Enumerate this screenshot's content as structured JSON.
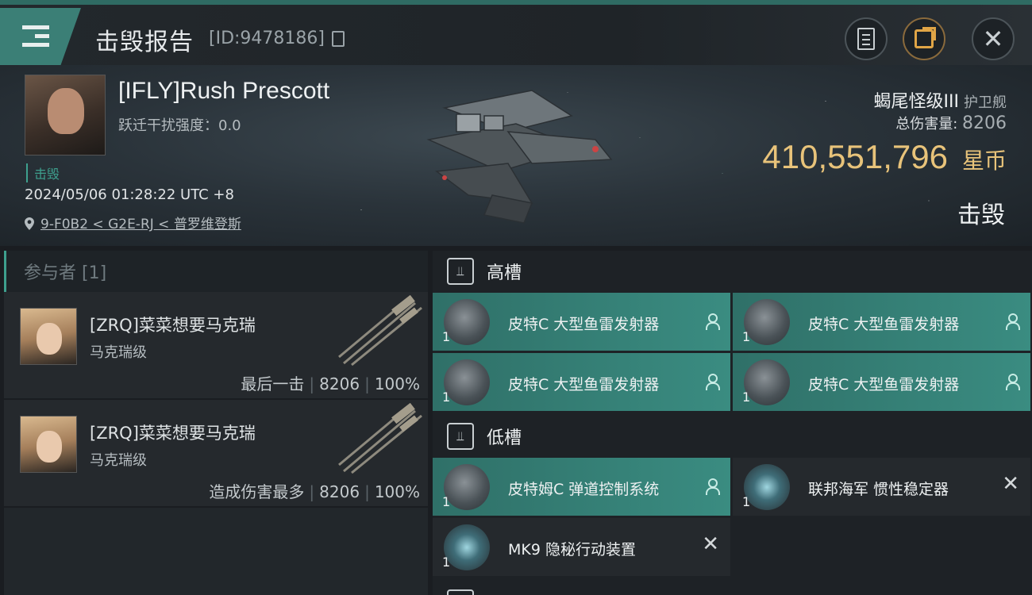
{
  "titlebar": {
    "title": "击毁报告",
    "report_id": "[ID:9478186]"
  },
  "victim": {
    "name": "[IFLY]Rush Prescott",
    "warp_disruption": "跃迁干扰强度：0.0",
    "status_tag": "击毁",
    "datetime": "2024/05/06 01:28:22 UTC +8",
    "location": "9-F0B2 < G2E-RJ < 普罗维登斯",
    "ship_name": "蝎尾怪级III",
    "ship_class": "护卫舰",
    "total_damage_label": "总伤害量: ",
    "total_damage": "8206",
    "isk_value": "410,551,796",
    "isk_unit": "星币",
    "result": "击毁"
  },
  "participants": {
    "header": "参与者 [1]",
    "rows": [
      {
        "name": "[ZRQ]菜菜想要马克瑞",
        "ship": "马克瑞级",
        "role": "最后一击",
        "damage": "8206",
        "percent": "100%"
      },
      {
        "name": "[ZRQ]菜菜想要马克瑞",
        "ship": "马克瑞级",
        "role": "造成伤害最多",
        "damage": "8206",
        "percent": "100%"
      }
    ]
  },
  "fitting": {
    "high_slot_label": "高槽",
    "low_slot_label": "低槽",
    "high_modules": [
      {
        "name": "皮特C 大型鱼雷发射器",
        "qty": "1"
      },
      {
        "name": "皮特C 大型鱼雷发射器",
        "qty": "1"
      },
      {
        "name": "皮特C 大型鱼雷发射器",
        "qty": "1"
      },
      {
        "name": "皮特C 大型鱼雷发射器",
        "qty": "1"
      }
    ],
    "low_modules": [
      {
        "name": "皮特姆C 弹道控制系统",
        "qty": "1"
      },
      {
        "name": "联邦海军 惯性稳定器",
        "qty": "1"
      },
      {
        "name": "MK9 隐秘行动装置",
        "qty": "1"
      }
    ]
  },
  "colors": {
    "accent": "#3ea08e",
    "fitted_module": "#3a8c81",
    "isk": "#e8c37a"
  },
  "icons": {
    "menu": "menu-icon",
    "copy": "copy-icon",
    "clipboard": "clipboard-icon",
    "share": "share-icon",
    "close": "close-icon",
    "location": "location-pin-icon",
    "slot": "slot-icon",
    "pilot": "pilot-icon",
    "remove": "x-icon"
  }
}
